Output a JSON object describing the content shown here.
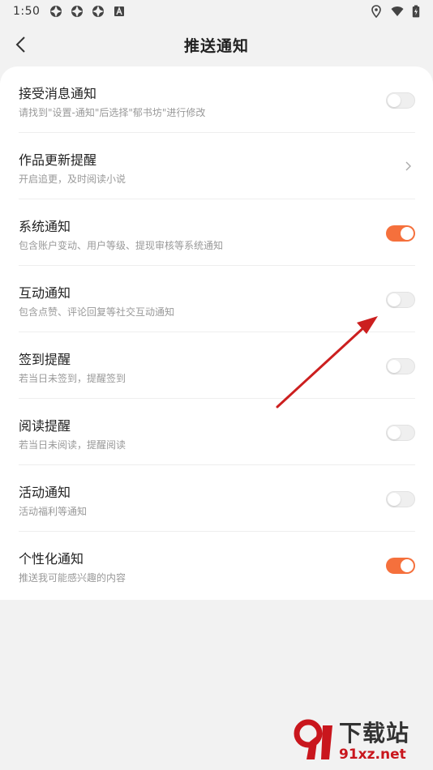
{
  "status_bar": {
    "time": "1:50",
    "left_icons": [
      "app-icon",
      "app-icon",
      "app-icon",
      "a-icon"
    ],
    "right_icons": [
      "location-icon",
      "wifi-icon",
      "battery-icon"
    ]
  },
  "header": {
    "back_icon": "chevron-left-icon",
    "title": "推送通知"
  },
  "colors": {
    "accent": "#f5703c",
    "toggle_off": "#efefef",
    "annotation_arrow": "#cc1f1f"
  },
  "settings": [
    {
      "title": "接受消息通知",
      "subtitle": "请找到\"设置-通知\"后选择\"郁书坊\"进行修改",
      "control": "toggle",
      "enabled": false
    },
    {
      "title": "作品更新提醒",
      "subtitle": "开启追更，及时阅读小说",
      "control": "chevron"
    },
    {
      "title": "系统通知",
      "subtitle": "包含账户变动、用户等级、提现审核等系统通知",
      "control": "toggle",
      "enabled": true
    },
    {
      "title": "互动通知",
      "subtitle": "包含点赞、评论回复等社交互动通知",
      "control": "toggle",
      "enabled": false
    },
    {
      "title": "签到提醒",
      "subtitle": "若当日未签到，提醒签到",
      "control": "toggle",
      "enabled": false
    },
    {
      "title": "阅读提醒",
      "subtitle": "若当日未阅读，提醒阅读",
      "control": "toggle",
      "enabled": false
    },
    {
      "title": "活动通知",
      "subtitle": "活动福利等通知",
      "control": "toggle",
      "enabled": false
    },
    {
      "title": "个性化通知",
      "subtitle": "推送我可能感兴趣的内容",
      "control": "toggle",
      "enabled": true
    }
  ],
  "watermark": {
    "text": "下载站",
    "url": "91xz.net"
  }
}
